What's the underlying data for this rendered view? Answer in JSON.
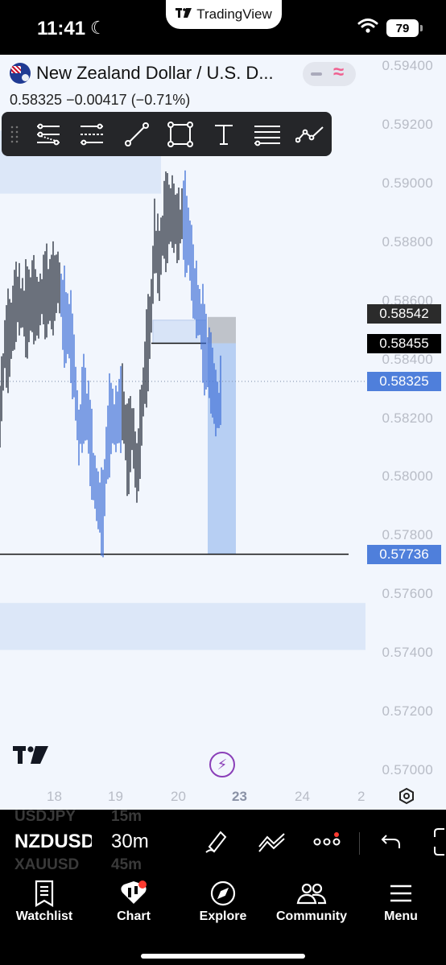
{
  "status_bar": {
    "time": "11:41",
    "app_pill_label": "TradingView",
    "battery": "79"
  },
  "symbol": {
    "title": "New Zealand Dollar / U.S. D...",
    "last": "0.58325",
    "change": "−0.00417",
    "change_pct": "(−0.71%)"
  },
  "drawing_toolbar": {
    "tools": [
      "trend-lines-icon",
      "fib-tools-icon",
      "brush-line-icon",
      "rectangle-icon",
      "text-icon",
      "parallel-channel-icon",
      "path-icon"
    ]
  },
  "chart_data": {
    "type": "candlestick",
    "instrument": "NZDUSD",
    "interval": "30m",
    "price_axis": {
      "labels": [
        "0.59400",
        "0.59200",
        "0.59000",
        "0.58800",
        "0.58600",
        "0.58400",
        "0.58200",
        "0.58000",
        "0.57800",
        "0.57600",
        "0.57400",
        "0.57200",
        "0.57000"
      ],
      "range": [
        0.5692,
        0.5949
      ]
    },
    "time_axis": {
      "labels": [
        "18",
        "19",
        "20",
        "23",
        "24",
        "2"
      ]
    },
    "price_tags": [
      {
        "label": "0.58542",
        "style": "dark"
      },
      {
        "label": "0.58455",
        "style": "black"
      },
      {
        "label": "0.58325",
        "style": "last-price"
      },
      {
        "label": "0.57736",
        "style": "blue"
      }
    ],
    "horizontal_line": 0.57736,
    "zones": [
      {
        "from": 0.58965,
        "to": 0.5918
      },
      {
        "from": 0.5741,
        "to": 0.5757
      }
    ],
    "short_position": {
      "entry": 0.58455,
      "stop": 0.58542,
      "target": 0.57736
    }
  },
  "bottom_toolbar": {
    "symbol_prev": "USDJPY",
    "symbol": "NZDUSD",
    "symbol_next": "XAUUSD",
    "interval_prev": "15m",
    "interval": "30m",
    "interval_next": "45m"
  },
  "tabbar": {
    "items": [
      "Watchlist",
      "Chart",
      "Explore",
      "Community",
      "Menu"
    ]
  },
  "colors": {
    "accent": "#4f7fdb",
    "background": "#f2f6fd",
    "candle": "#3e6fd8"
  }
}
